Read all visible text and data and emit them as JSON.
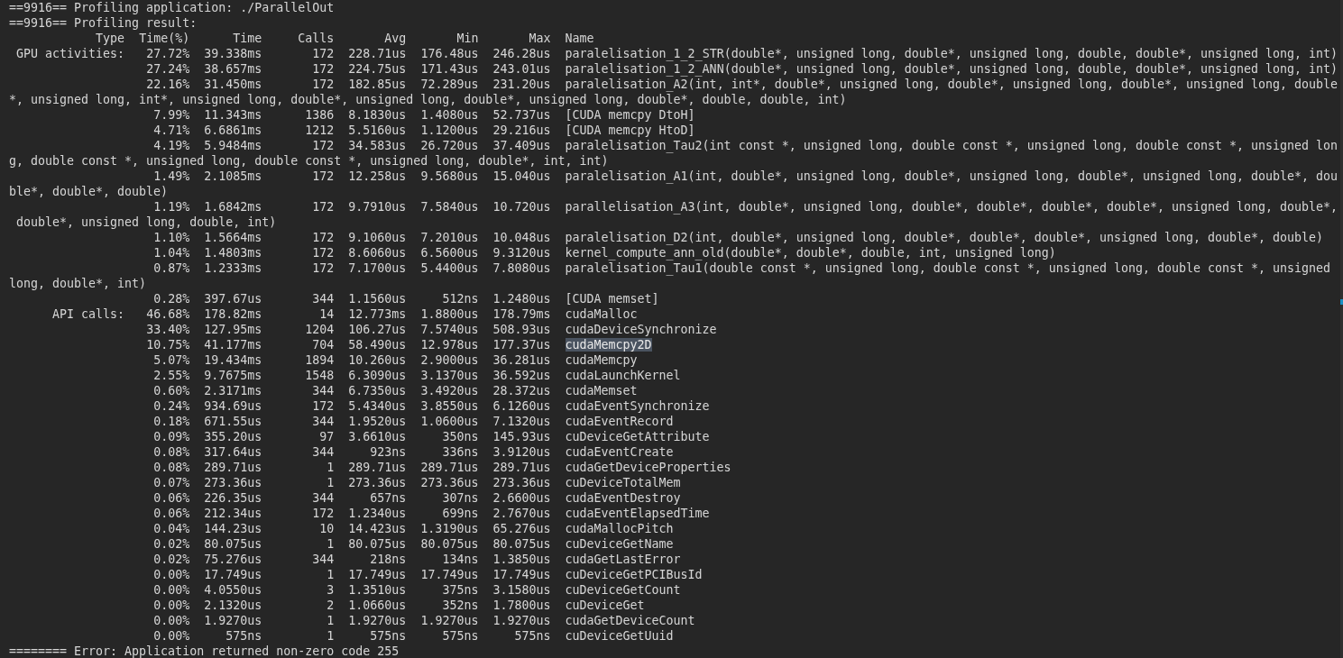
{
  "header_lines": [
    "==9916== Profiling application: ./ParallelOut",
    "==9916== Profiling result:"
  ],
  "table": {
    "columns": [
      "Type",
      "Time(%)",
      "Time",
      "Calls",
      "Avg",
      "Min",
      "Max",
      "Name"
    ],
    "groups": [
      {
        "type": "GPU activities:",
        "rows": [
          {
            "time_pct": "27.72%",
            "time": "39.338ms",
            "calls": "172",
            "avg": "228.71us",
            "min": "176.48us",
            "max": "246.28us",
            "name": "paralelisation_1_2_STR(double*, unsigned long, double*, unsigned long, double, double*, unsigned long, int)",
            "selected": false
          },
          {
            "time_pct": "27.24%",
            "time": "38.657ms",
            "calls": "172",
            "avg": "224.75us",
            "min": "171.43us",
            "max": "243.01us",
            "name": "paralelisation_1_2_ANN(double*, unsigned long, double*, unsigned long, double, double*, unsigned long, int)",
            "selected": false
          },
          {
            "time_pct": "22.16%",
            "time": "31.450ms",
            "calls": "172",
            "avg": "182.85us",
            "min": "72.289us",
            "max": "231.20us",
            "name": "paralelisation_A2(int, int*, double*, unsigned long, double*, unsigned long, double*, unsigned long, double*, unsigned long, int*, unsigned long, double*, unsigned long, double*, unsigned long, double*, double, double, int)",
            "selected": false
          },
          {
            "time_pct": "7.99%",
            "time": "11.343ms",
            "calls": "1386",
            "avg": "8.1830us",
            "min": "1.4080us",
            "max": "52.737us",
            "name": "[CUDA memcpy DtoH]",
            "selected": false
          },
          {
            "time_pct": "4.71%",
            "time": "6.6861ms",
            "calls": "1212",
            "avg": "5.5160us",
            "min": "1.1200us",
            "max": "29.216us",
            "name": "[CUDA memcpy HtoD]",
            "selected": false
          },
          {
            "time_pct": "4.19%",
            "time": "5.9484ms",
            "calls": "172",
            "avg": "34.583us",
            "min": "26.720us",
            "max": "37.409us",
            "name": "paralelisation_Tau2(int const *, unsigned long, double const *, unsigned long, double const *, unsigned long, double const *, unsigned long, double const *, unsigned long, double*, int, int)",
            "selected": false
          },
          {
            "time_pct": "1.49%",
            "time": "2.1085ms",
            "calls": "172",
            "avg": "12.258us",
            "min": "9.5680us",
            "max": "15.040us",
            "name": "paralelisation_A1(int, double*, unsigned long, double*, unsigned long, double*, unsigned long, double*, double*, double*, double)",
            "selected": false
          },
          {
            "time_pct": "1.19%",
            "time": "1.6842ms",
            "calls": "172",
            "avg": "9.7910us",
            "min": "7.5840us",
            "max": "10.720us",
            "name": "parallelisation_A3(int, double*, unsigned long, double*, double*, double*, double*, unsigned long, double*, double*, unsigned long, double, int)",
            "selected": false
          },
          {
            "time_pct": "1.10%",
            "time": "1.5664ms",
            "calls": "172",
            "avg": "9.1060us",
            "min": "7.2010us",
            "max": "10.048us",
            "name": "paralelisation_D2(int, double*, unsigned long, double*, double*, double*, unsigned long, double*, double)",
            "selected": false
          },
          {
            "time_pct": "1.04%",
            "time": "1.4803ms",
            "calls": "172",
            "avg": "8.6060us",
            "min": "6.5600us",
            "max": "9.3120us",
            "name": "kernel_compute_ann_old(double*, double*, double, int, unsigned long)",
            "selected": false
          },
          {
            "time_pct": "0.87%",
            "time": "1.2333ms",
            "calls": "172",
            "avg": "7.1700us",
            "min": "5.4400us",
            "max": "7.8080us",
            "name": "paralelisation_Tau1(double const *, unsigned long, double const *, unsigned long, double const *, unsigned long, double*, int)",
            "selected": false
          },
          {
            "time_pct": "0.28%",
            "time": "397.67us",
            "calls": "344",
            "avg": "1.1560us",
            "min": "512ns",
            "max": "1.2480us",
            "name": "[CUDA memset]",
            "selected": false
          }
        ]
      },
      {
        "type": "API calls:",
        "rows": [
          {
            "time_pct": "46.68%",
            "time": "178.82ms",
            "calls": "14",
            "avg": "12.773ms",
            "min": "1.8800us",
            "max": "178.79ms",
            "name": "cudaMalloc",
            "selected": false
          },
          {
            "time_pct": "33.40%",
            "time": "127.95ms",
            "calls": "1204",
            "avg": "106.27us",
            "min": "7.5740us",
            "max": "508.93us",
            "name": "cudaDeviceSynchronize",
            "selected": false
          },
          {
            "time_pct": "10.75%",
            "time": "41.177ms",
            "calls": "704",
            "avg": "58.490us",
            "min": "12.978us",
            "max": "177.37us",
            "name": "cudaMemcpy2D",
            "selected": true
          },
          {
            "time_pct": "5.07%",
            "time": "19.434ms",
            "calls": "1894",
            "avg": "10.260us",
            "min": "2.9000us",
            "max": "36.281us",
            "name": "cudaMemcpy",
            "selected": false
          },
          {
            "time_pct": "2.55%",
            "time": "9.7675ms",
            "calls": "1548",
            "avg": "6.3090us",
            "min": "3.1370us",
            "max": "36.592us",
            "name": "cudaLaunchKernel",
            "selected": false
          },
          {
            "time_pct": "0.60%",
            "time": "2.3171ms",
            "calls": "344",
            "avg": "6.7350us",
            "min": "3.4920us",
            "max": "28.372us",
            "name": "cudaMemset",
            "selected": false
          },
          {
            "time_pct": "0.24%",
            "time": "934.69us",
            "calls": "172",
            "avg": "5.4340us",
            "min": "3.8550us",
            "max": "6.1260us",
            "name": "cudaEventSynchronize",
            "selected": false
          },
          {
            "time_pct": "0.18%",
            "time": "671.55us",
            "calls": "344",
            "avg": "1.9520us",
            "min": "1.0600us",
            "max": "7.1320us",
            "name": "cudaEventRecord",
            "selected": false
          },
          {
            "time_pct": "0.09%",
            "time": "355.20us",
            "calls": "97",
            "avg": "3.6610us",
            "min": "350ns",
            "max": "145.93us",
            "name": "cuDeviceGetAttribute",
            "selected": false
          },
          {
            "time_pct": "0.08%",
            "time": "317.64us",
            "calls": "344",
            "avg": "923ns",
            "min": "336ns",
            "max": "3.9120us",
            "name": "cudaEventCreate",
            "selected": false
          },
          {
            "time_pct": "0.08%",
            "time": "289.71us",
            "calls": "1",
            "avg": "289.71us",
            "min": "289.71us",
            "max": "289.71us",
            "name": "cudaGetDeviceProperties",
            "selected": false
          },
          {
            "time_pct": "0.07%",
            "time": "273.36us",
            "calls": "1",
            "avg": "273.36us",
            "min": "273.36us",
            "max": "273.36us",
            "name": "cuDeviceTotalMem",
            "selected": false
          },
          {
            "time_pct": "0.06%",
            "time": "226.35us",
            "calls": "344",
            "avg": "657ns",
            "min": "307ns",
            "max": "2.6600us",
            "name": "cudaEventDestroy",
            "selected": false
          },
          {
            "time_pct": "0.06%",
            "time": "212.34us",
            "calls": "172",
            "avg": "1.2340us",
            "min": "699ns",
            "max": "2.7670us",
            "name": "cudaEventElapsedTime",
            "selected": false
          },
          {
            "time_pct": "0.04%",
            "time": "144.23us",
            "calls": "10",
            "avg": "14.423us",
            "min": "1.3190us",
            "max": "65.276us",
            "name": "cudaMallocPitch",
            "selected": false
          },
          {
            "time_pct": "0.02%",
            "time": "80.075us",
            "calls": "1",
            "avg": "80.075us",
            "min": "80.075us",
            "max": "80.075us",
            "name": "cuDeviceGetName",
            "selected": false
          },
          {
            "time_pct": "0.02%",
            "time": "75.276us",
            "calls": "344",
            "avg": "218ns",
            "min": "134ns",
            "max": "1.3850us",
            "name": "cudaGetLastError",
            "selected": false
          },
          {
            "time_pct": "0.00%",
            "time": "17.749us",
            "calls": "1",
            "avg": "17.749us",
            "min": "17.749us",
            "max": "17.749us",
            "name": "cuDeviceGetPCIBusId",
            "selected": false
          },
          {
            "time_pct": "0.00%",
            "time": "4.0550us",
            "calls": "3",
            "avg": "1.3510us",
            "min": "375ns",
            "max": "3.1580us",
            "name": "cuDeviceGetCount",
            "selected": false
          },
          {
            "time_pct": "0.00%",
            "time": "2.1320us",
            "calls": "2",
            "avg": "1.0660us",
            "min": "352ns",
            "max": "1.7800us",
            "name": "cuDeviceGet",
            "selected": false
          },
          {
            "time_pct": "0.00%",
            "time": "1.9270us",
            "calls": "1",
            "avg": "1.9270us",
            "min": "1.9270us",
            "max": "1.9270us",
            "name": "cudaGetDeviceCount",
            "selected": false
          },
          {
            "time_pct": "0.00%",
            "time": "575ns",
            "calls": "1",
            "avg": "575ns",
            "min": "575ns",
            "max": "575ns",
            "name": "cuDeviceGetUuid",
            "selected": false
          }
        ]
      }
    ]
  },
  "footer": "======== Error: Application returned non-zero code 255"
}
